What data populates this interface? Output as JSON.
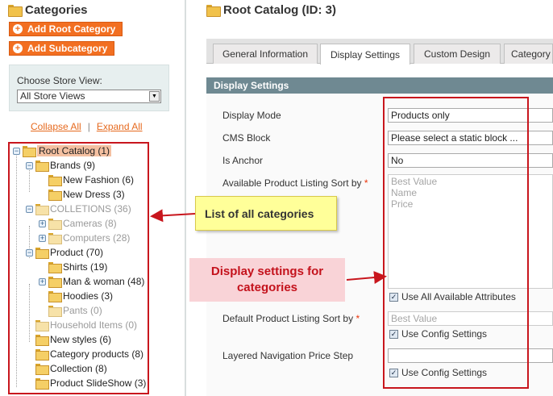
{
  "sidebar": {
    "title": "Categories",
    "add_root_label": "Add Root Category",
    "add_sub_label": "Add Subcategory",
    "store_view_label": "Choose Store View:",
    "store_view_value": "All Store Views",
    "collapse_all": "Collapse All",
    "separator": "|",
    "expand_all": "Expand All",
    "tree": [
      {
        "label": "Root Catalog (1)",
        "level": 0,
        "toggle": "-",
        "selected": true,
        "dim": false
      },
      {
        "label": "Brands (9)",
        "level": 1,
        "toggle": "-",
        "dim": false
      },
      {
        "label": "New Fashion (6)",
        "level": 2,
        "toggle": "",
        "dim": false
      },
      {
        "label": "New Dress (3)",
        "level": 2,
        "toggle": "",
        "dim": false
      },
      {
        "label": "COLLETIONS (36)",
        "level": 1,
        "toggle": "-",
        "dim": true
      },
      {
        "label": "Cameras (8)",
        "level": 2,
        "toggle": "+",
        "dim": true
      },
      {
        "label": "Computers (28)",
        "level": 2,
        "toggle": "+",
        "dim": true
      },
      {
        "label": "Product (70)",
        "level": 1,
        "toggle": "-",
        "dim": false
      },
      {
        "label": "Shirts (19)",
        "level": 2,
        "toggle": "",
        "dim": false
      },
      {
        "label": "Man & woman (48)",
        "level": 2,
        "toggle": "+",
        "dim": false
      },
      {
        "label": "Hoodies (3)",
        "level": 2,
        "toggle": "",
        "dim": false
      },
      {
        "label": "Pants (0)",
        "level": 2,
        "toggle": "",
        "dim": true
      },
      {
        "label": "Household Items (0)",
        "level": 1,
        "toggle": "",
        "dim": true
      },
      {
        "label": "New styles (6)",
        "level": 1,
        "toggle": "",
        "dim": false
      },
      {
        "label": "Category products (8)",
        "level": 1,
        "toggle": "",
        "dim": false
      },
      {
        "label": "Collection (8)",
        "level": 1,
        "toggle": "",
        "dim": false
      },
      {
        "label": "Product SlideShow (3)",
        "level": 1,
        "toggle": "",
        "dim": false
      }
    ]
  },
  "main": {
    "title": "Root Catalog (ID: 3)",
    "tabs": [
      {
        "label": "General Information",
        "active": false
      },
      {
        "label": "Display Settings",
        "active": true
      },
      {
        "label": "Custom Design",
        "active": false
      },
      {
        "label": "Category",
        "active": false
      }
    ],
    "section_title": "Display Settings",
    "fields": {
      "display_mode": {
        "label": "Display Mode",
        "value": "Products only"
      },
      "cms_block": {
        "label": "CMS Block",
        "value": "Please select a static block ..."
      },
      "is_anchor": {
        "label": "Is Anchor",
        "value": "No"
      },
      "available_sort": {
        "label": "Available Product Listing Sort by",
        "required_mark": "*",
        "options": [
          "Best Value",
          "Name",
          "Price"
        ],
        "checkbox_label": "Use All Available Attributes"
      },
      "default_sort": {
        "label": "Default Product Listing Sort by",
        "required_mark": "*",
        "value": "Best Value",
        "checkbox_label": "Use Config Settings"
      },
      "price_step": {
        "label": "Layered Navigation Price Step",
        "value": "",
        "checkbox_label": "Use Config Settings"
      }
    }
  },
  "annotations": {
    "list_note": "List of all categories",
    "display_note_line1": "Display settings for",
    "display_note_line2": "categories"
  },
  "colors": {
    "accent_orange": "#f26f21",
    "section_header": "#6f8992",
    "annotation_red": "#c8161d",
    "note_yellow": "#ffff99",
    "note_pink": "#f9d3d7"
  }
}
